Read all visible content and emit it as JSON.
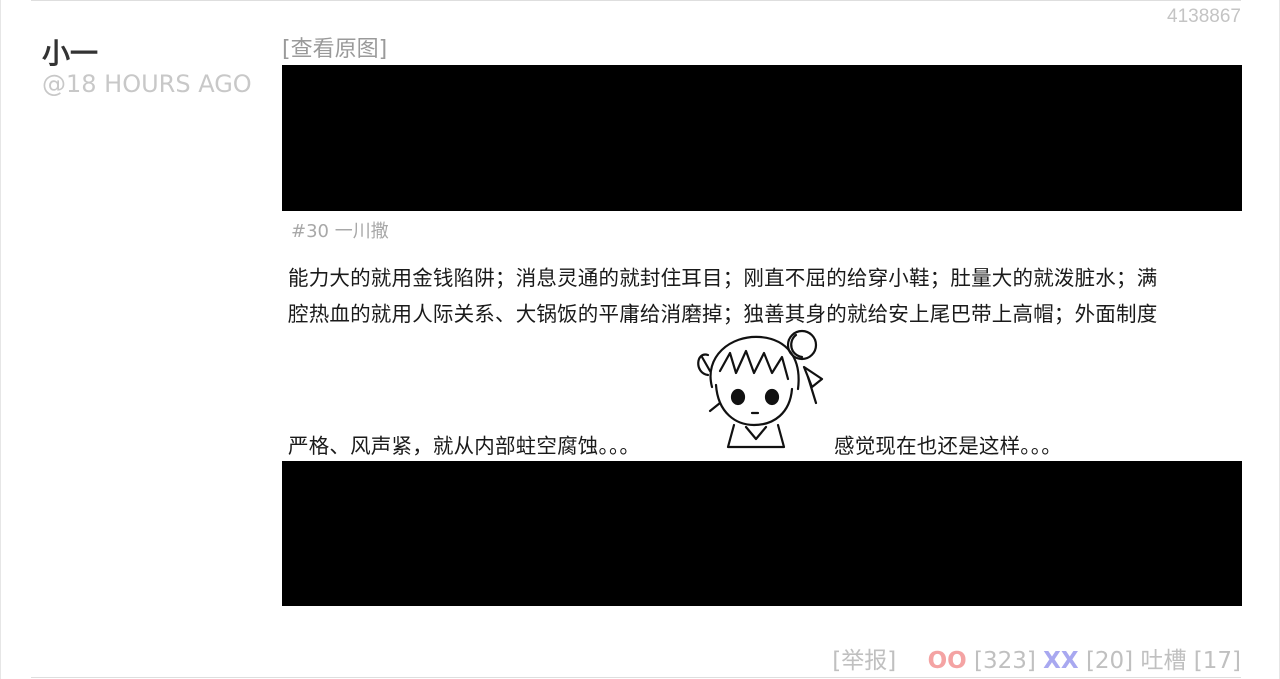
{
  "post": {
    "id": "4138867",
    "author": "小一",
    "time": "@18 HOURS AGO",
    "view_original": "[查看原图]"
  },
  "image_text": {
    "tag": "#30 一川撒",
    "line1": "能力大的就用金钱陷阱；消息灵通的就封住耳目；刚直不屈的给穿小鞋；肚量大的就泼脏水；满",
    "line2": "腔热血的就用人际关系、大锅饭的平庸给消磨掉；独善其身的就给安上尾巴带上高帽；外面制度",
    "line3": "严格、风声紧，就从内部蛀空腐蚀。。。",
    "line4": "感觉现在也还是这样。。。"
  },
  "footer": {
    "report": "[举报]",
    "oo_label": "OO",
    "oo_count": "[323]",
    "xx_label": "XX",
    "xx_count": "[20]",
    "comment_label": "吐槽",
    "comment_count": "[17]"
  },
  "colors": {
    "oo": "#f4a3a3",
    "xx": "#a8a8f0",
    "muted": "#c0c0c0"
  },
  "icons": {
    "image_drawing": "chibi-girl-icon"
  }
}
